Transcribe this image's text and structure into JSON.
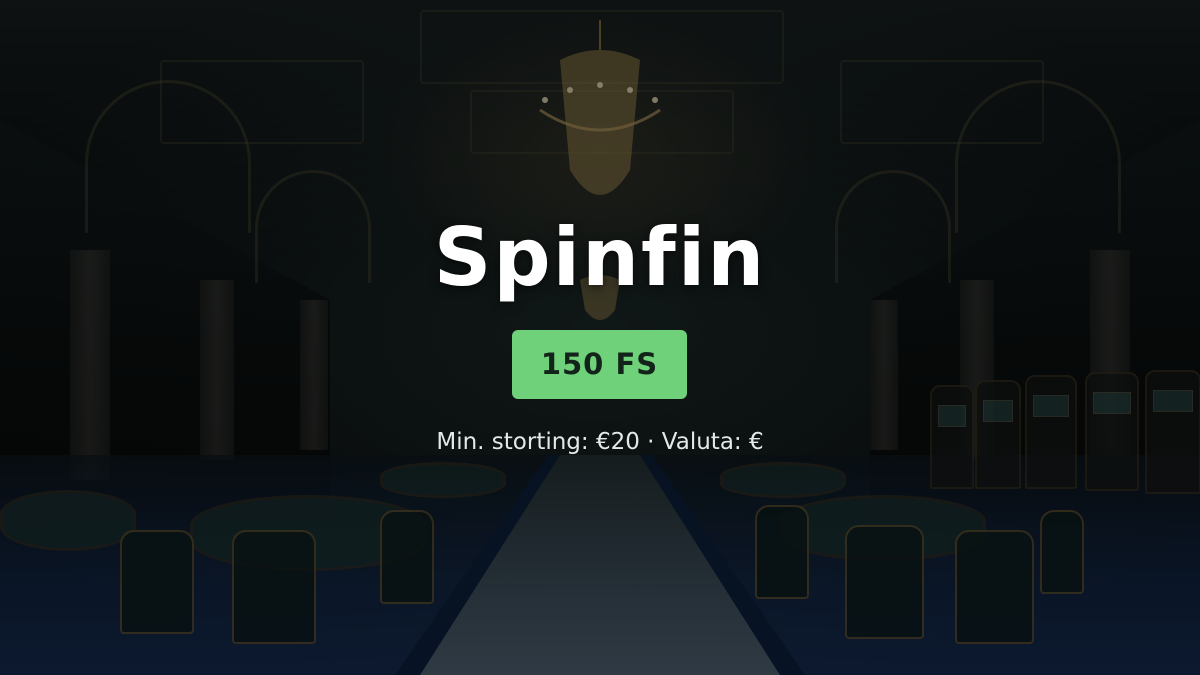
{
  "banner": {
    "brand": "Spinfin",
    "offer_badge": "150 FS",
    "details": "Min. storting: €20 · Valuta: €"
  },
  "colors": {
    "badge_background": "#6fd17a",
    "badge_text": "#12241a",
    "brand_text": "#ffffff",
    "details_text": "#e4e8e8"
  },
  "background": {
    "scene": "casino-hall-photo"
  }
}
